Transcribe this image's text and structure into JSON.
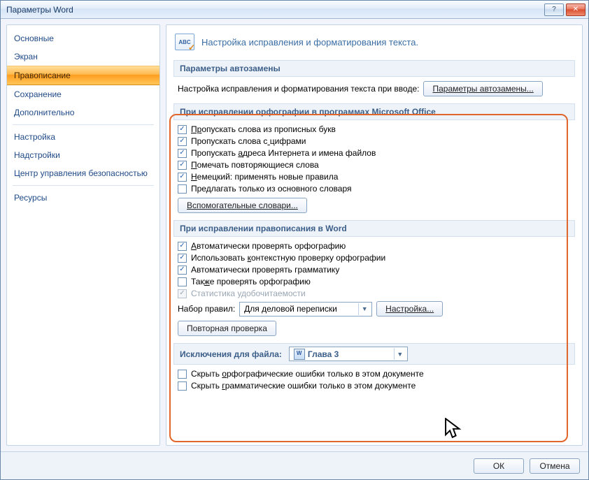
{
  "window": {
    "title": "Параметры Word",
    "help_label": "?",
    "close_label": "✕"
  },
  "sidebar": {
    "items": [
      {
        "label": "Основные"
      },
      {
        "label": "Экран"
      },
      {
        "label": "Правописание"
      },
      {
        "label": "Сохранение"
      },
      {
        "label": "Дополнительно"
      },
      {
        "label": "Настройка"
      },
      {
        "label": "Надстройки"
      },
      {
        "label": "Центр управления безопасностью"
      },
      {
        "label": "Ресурсы"
      }
    ],
    "selected_index": 2,
    "separators_after": [
      4,
      7
    ]
  },
  "page": {
    "icon_text": "ABC",
    "title": "Настройка исправления и форматирования текста."
  },
  "autocorrect": {
    "heading": "Параметры автозамены",
    "desc": "Настройка исправления и форматирования текста при вводе:",
    "button": "Параметры автозамены..."
  },
  "spelling_office": {
    "heading": "При исправлении орфографии в программах Microsoft Office",
    "checks": [
      {
        "checked": true,
        "label": "Пропускать слова из прописных букв",
        "u": [
          0,
          2
        ]
      },
      {
        "checked": true,
        "label": "Пропускать слова с цифрами",
        "u": [
          18,
          19
        ]
      },
      {
        "checked": true,
        "label": "Пропускать адреса Интернета и имена файлов",
        "u": [
          11,
          12
        ]
      },
      {
        "checked": true,
        "label": "Помечать повторяющиеся слова",
        "u": [
          0,
          1
        ]
      },
      {
        "checked": true,
        "label": "Немецкий: применять новые правила",
        "u": [
          0,
          1
        ]
      },
      {
        "checked": false,
        "label": "Предлагать только из основного словаря"
      }
    ],
    "dict_button": "Вспомогательные словари..."
  },
  "spelling_word": {
    "heading": "При исправлении правописания в Word",
    "checks": [
      {
        "checked": true,
        "label": "Автоматически проверять орфографию",
        "u": [
          0,
          1
        ]
      },
      {
        "checked": true,
        "label": "Использовать контекстную проверку орфографии",
        "u": [
          13,
          14
        ]
      },
      {
        "checked": true,
        "label": "Автоматически проверять грамматику"
      },
      {
        "checked": false,
        "label": "Также проверять орфографию",
        "u": [
          3,
          4
        ]
      },
      {
        "checked": true,
        "disabled": true,
        "label": "Статистика удобочитаемости"
      }
    ],
    "ruleset_label": "Набор правил:",
    "ruleset_value": "Для деловой переписки",
    "ruleset_settings": "Настройка...",
    "recheck_button": "Повторная проверка"
  },
  "exceptions": {
    "heading": "Исключения для файла:",
    "file_value": "Глава 3",
    "checks": [
      {
        "checked": false,
        "label": "Скрыть орфографические ошибки только в этом документе",
        "u": [
          7,
          8
        ]
      },
      {
        "checked": false,
        "label": "Скрыть грамматические ошибки только в этом документе",
        "u": [
          7,
          8
        ]
      }
    ]
  },
  "footer": {
    "ok": "ОК",
    "cancel": "Отмена"
  }
}
